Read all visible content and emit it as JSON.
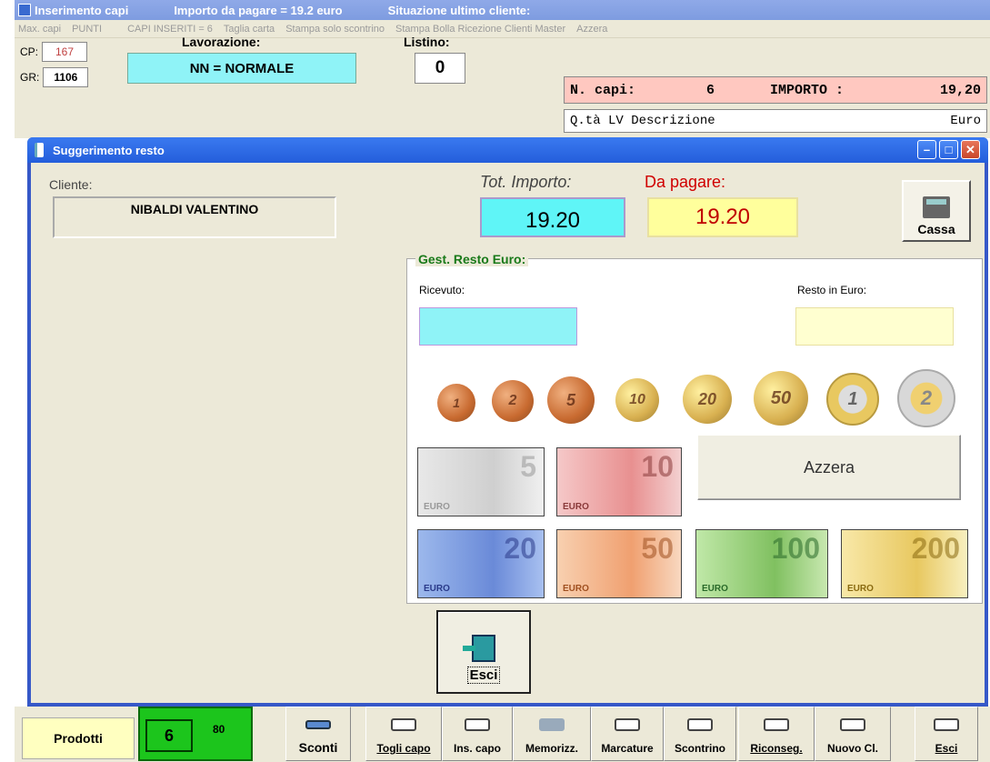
{
  "bg": {
    "title_parts": [
      "Inserimento capi",
      "Importo da pagare = 19.2 euro",
      "Situazione ultimo cliente:"
    ],
    "menu": [
      "Max. capi",
      "PUNTI",
      "CAPI INSERITI = 6",
      "Taglia carta",
      "Stampa solo scontrino",
      "Stampa Bolla Ricezione Clienti Master",
      "Azzera"
    ],
    "cp_label": "CP:",
    "cp_value": "167",
    "gr_label": "GR:",
    "gr_value": "1106",
    "lavorazione_label": "Lavorazione:",
    "lavorazione_value": "NN = NORMALE",
    "listino_label": "Listino:",
    "listino_value": "0",
    "ncapi_label": "N. capi:",
    "ncapi_value": "6",
    "importo_label": "IMPORTO :",
    "importo_value": "19,20",
    "desc_header_left": "Q.tà LV Descrizione",
    "desc_header_right": "Euro"
  },
  "dialog": {
    "title": "Suggerimento resto",
    "cliente_label": "Cliente:",
    "cliente_value": "NIBALDI VALENTINO",
    "tot_label": "Tot. Importo:",
    "tot_value": "19.20",
    "pay_label": "Da pagare:",
    "pay_value": "19.20",
    "cassa_label": "Cassa",
    "resto_group_title": "Gest. Resto Euro:",
    "ricevuto_label": "Ricevuto:",
    "ricevuto_value": "",
    "resto_label": "Resto in Euro:",
    "resto_value": "",
    "coins": [
      "1",
      "2",
      "5",
      "10",
      "20",
      "50",
      "1",
      "2"
    ],
    "notes": [
      "5",
      "10",
      "20",
      "50",
      "100",
      "200"
    ],
    "note_small": "EURO",
    "azzera_label": "Azzera",
    "esci_label": "Esci"
  },
  "toolbar": {
    "prodotti": "Prodotti",
    "green_count": "6",
    "green_small": "80",
    "buttons": [
      "Sconti",
      "Togli capo",
      "Ins. capo",
      "Memorizz.",
      "Marcature",
      "Scontrino",
      "Riconseg.",
      "Nuovo Cl.",
      "Esci"
    ]
  },
  "colors": {
    "cyan": "#8ff3f7",
    "yellow": "#ffff9c",
    "title_blue": "#245edb",
    "green": "#1cc51c"
  }
}
